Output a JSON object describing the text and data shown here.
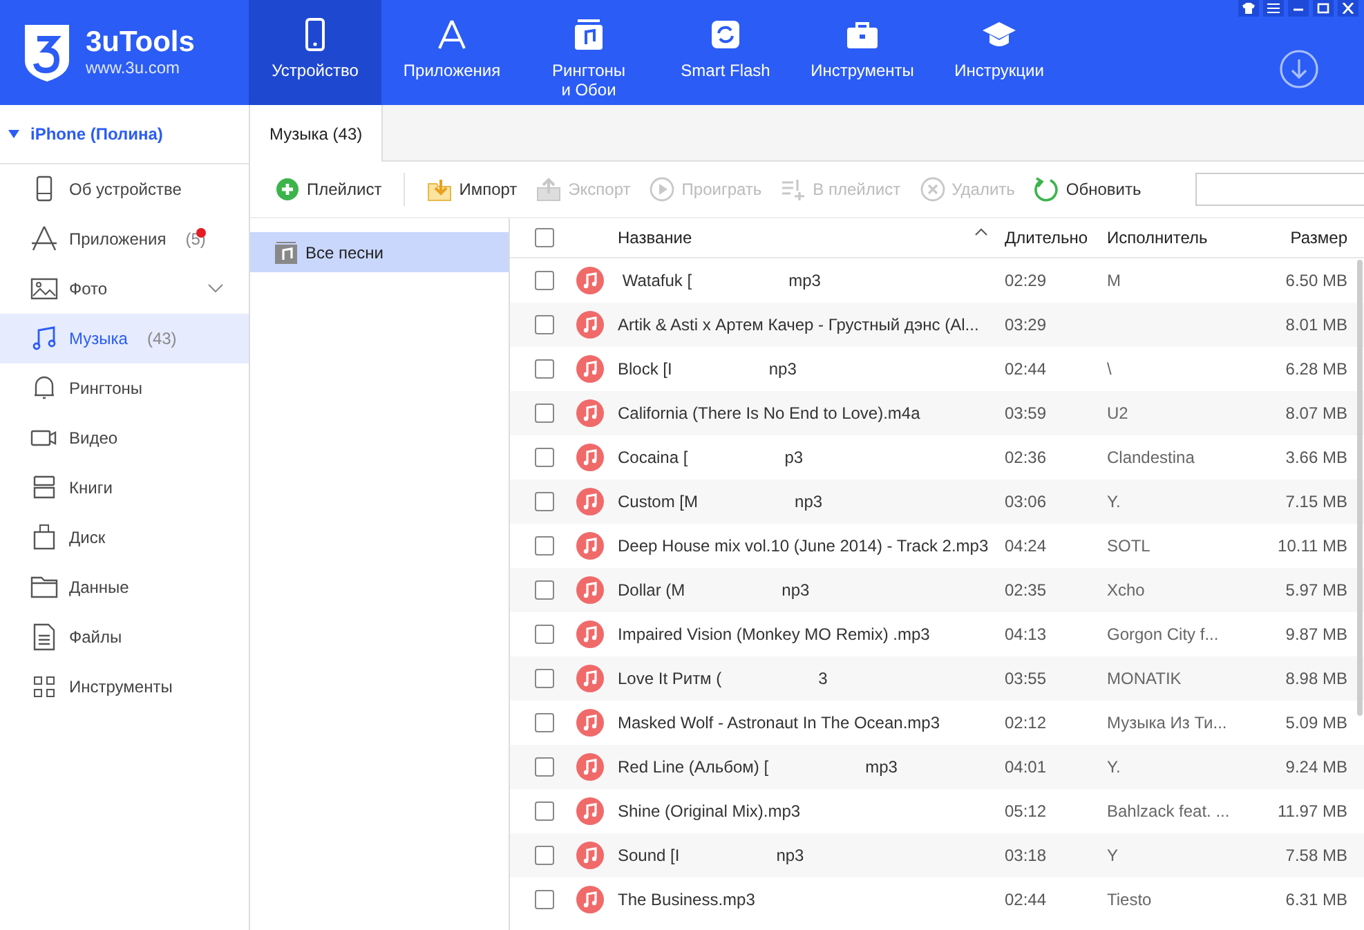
{
  "app": {
    "name": "3uTools",
    "site": "www.3u.com"
  },
  "nav": [
    {
      "label": "Устройство",
      "selected": true
    },
    {
      "label": "Приложения",
      "selected": false
    },
    {
      "label": "Рингтоны\nи Обои",
      "selected": false
    },
    {
      "label": "Smart Flash",
      "selected": false
    },
    {
      "label": "Инструменты",
      "selected": false
    },
    {
      "label": "Инструкции",
      "selected": false
    }
  ],
  "sidebar": {
    "device": "iPhone (Полина)",
    "expanded": true,
    "items": [
      {
        "label": "Об устройстве",
        "selected": false
      },
      {
        "label": "Приложения",
        "count": "(5)",
        "badge": true,
        "selected": false
      },
      {
        "label": "Фото",
        "expandable": true,
        "selected": false
      },
      {
        "label": "Музыка",
        "count": "(43)",
        "selected": true
      },
      {
        "label": "Рингтоны",
        "selected": false
      },
      {
        "label": "Видео",
        "selected": false
      },
      {
        "label": "Книги",
        "selected": false
      },
      {
        "label": "Диск",
        "selected": false
      },
      {
        "label": "Данные",
        "selected": false
      },
      {
        "label": "Файлы",
        "selected": false
      },
      {
        "label": "Инструменты",
        "selected": false
      }
    ]
  },
  "tab": {
    "label": "Музыка (43)"
  },
  "toolbar": [
    {
      "label": "Плейлист",
      "disabled": false
    },
    {
      "label": "Импорт",
      "disabled": false
    },
    {
      "label": "Экспорт",
      "disabled": true
    },
    {
      "label": "Проиграть",
      "disabled": true
    },
    {
      "label": "В плейлист",
      "disabled": true
    },
    {
      "label": "Удалить",
      "disabled": true
    },
    {
      "label": "Обновить",
      "disabled": false
    }
  ],
  "playlists": [
    {
      "label": "Все песни",
      "selected": true
    }
  ],
  "table": {
    "columns": [
      "Название",
      "Длительно",
      "Исполнитель",
      "Размер"
    ],
    "all_checked": false,
    "rows": [
      {
        "name": [
          " Watafuk [",
          "mp3"
        ],
        "duration": "02:29",
        "artist": "M",
        "size": "6.50 MB",
        "checked": false
      },
      {
        "name": [
          "Artik & Asti x Артем Качер - Грустный дэнс (Al..."
        ],
        "duration": "03:29",
        "size": "8.01 MB",
        "checked": false
      },
      {
        "name": [
          "Block [I",
          "np3"
        ],
        "duration": "02:44",
        "artist": "\\",
        "size": "6.28 MB",
        "checked": false
      },
      {
        "name": [
          "California (There Is No End to Love).m4a"
        ],
        "duration": "03:59",
        "artist": "U2",
        "size": "8.07 MB",
        "checked": false
      },
      {
        "name": [
          "Cocaina [",
          "p3"
        ],
        "duration": "02:36",
        "artist": "Clandestina",
        "size": "3.66 MB",
        "checked": false
      },
      {
        "name": [
          "Custom [M",
          "np3"
        ],
        "duration": "03:06",
        "artist": "Y.",
        "size": "7.15 MB",
        "checked": false
      },
      {
        "name": [
          "Deep House mix vol.10 (June 2014) - Track 2.mp3"
        ],
        "duration": "04:24",
        "artist": "SOTL",
        "size": "10.11 MB",
        "checked": false
      },
      {
        "name": [
          "Dollar (M",
          "np3"
        ],
        "duration": "02:35",
        "artist": "Xcho",
        "size": "5.97 MB",
        "checked": false
      },
      {
        "name": [
          "Impaired Vision (Monkey MO Remix) .mp3"
        ],
        "duration": "04:13",
        "artist": "Gorgon City f...",
        "size": "9.87 MB",
        "checked": false
      },
      {
        "name": [
          "Love It Ритм (",
          "3"
        ],
        "duration": "03:55",
        "artist": "MONATIK",
        "size": "8.98 MB",
        "checked": false
      },
      {
        "name": [
          "Masked Wolf - Astronaut In The Ocean.mp3"
        ],
        "duration": "02:12",
        "artist": "Музыка Из Ти...",
        "size": "5.09 MB",
        "checked": false
      },
      {
        "name": [
          "Red Line (Альбом) [",
          "mp3"
        ],
        "duration": "04:01",
        "artist": "Y.",
        "size": "9.24 MB",
        "checked": false
      },
      {
        "name": [
          "Shine (Original Mix).mp3"
        ],
        "duration": "05:12",
        "artist": "Bahlzack feat. ...",
        "size": "11.97 MB",
        "checked": false
      },
      {
        "name": [
          "Sound [I",
          "np3"
        ],
        "duration": "03:18",
        "artist": "Y",
        "size": "7.58 MB",
        "checked": false
      },
      {
        "name": [
          "The Business.mp3"
        ],
        "duration": "02:44",
        "artist": "Tiesto",
        "size": "6.31 MB",
        "checked": false
      }
    ]
  }
}
